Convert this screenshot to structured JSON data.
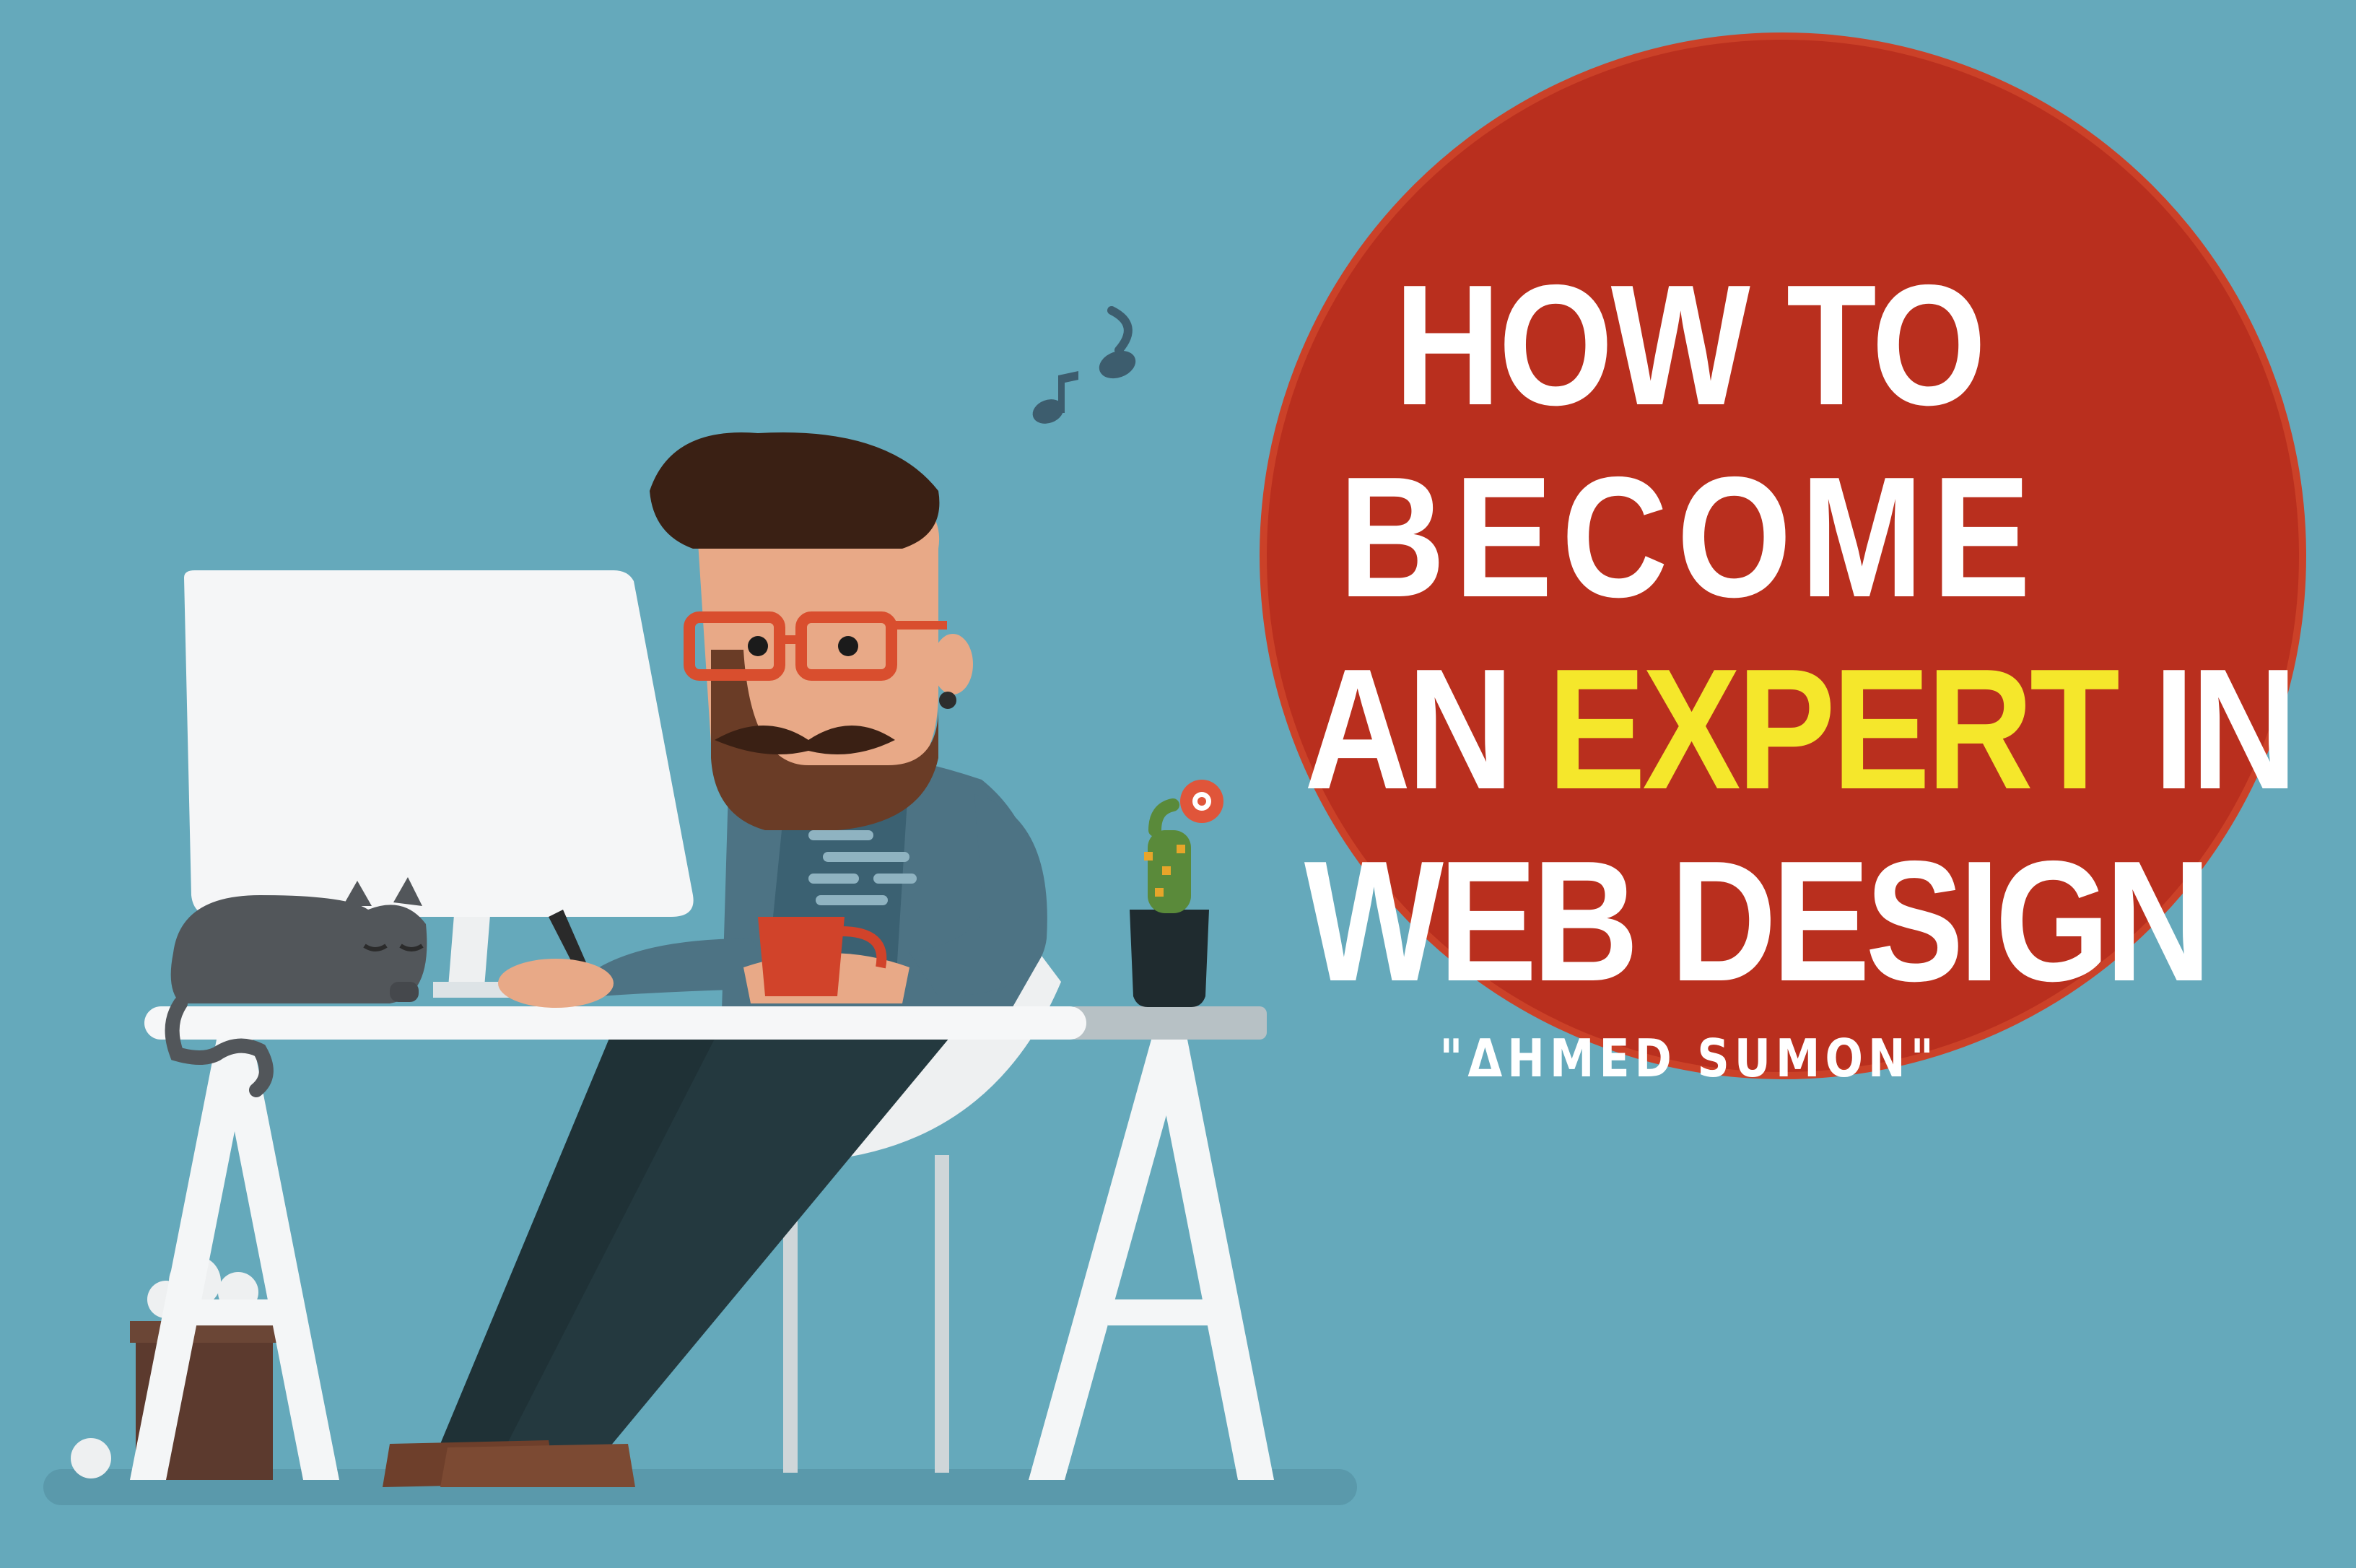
{
  "headline": {
    "line1": "HOW TO",
    "line2": "BECOME",
    "line3_before": "AN ",
    "line3_highlight": "EXPERT",
    "line3_after": " IN",
    "line4": "WEB DESIGN"
  },
  "author": "\"ΔHMED SUMON\"",
  "colors": {
    "background": "#65a9bb",
    "badge": "#b92f1e",
    "headline_text": "#ffffff",
    "highlight_text": "#f5e72b"
  },
  "illustration": {
    "icons": [
      "music-note-icon",
      "cactus-plant-icon",
      "cat-icon",
      "coffee-mug-icon"
    ]
  }
}
